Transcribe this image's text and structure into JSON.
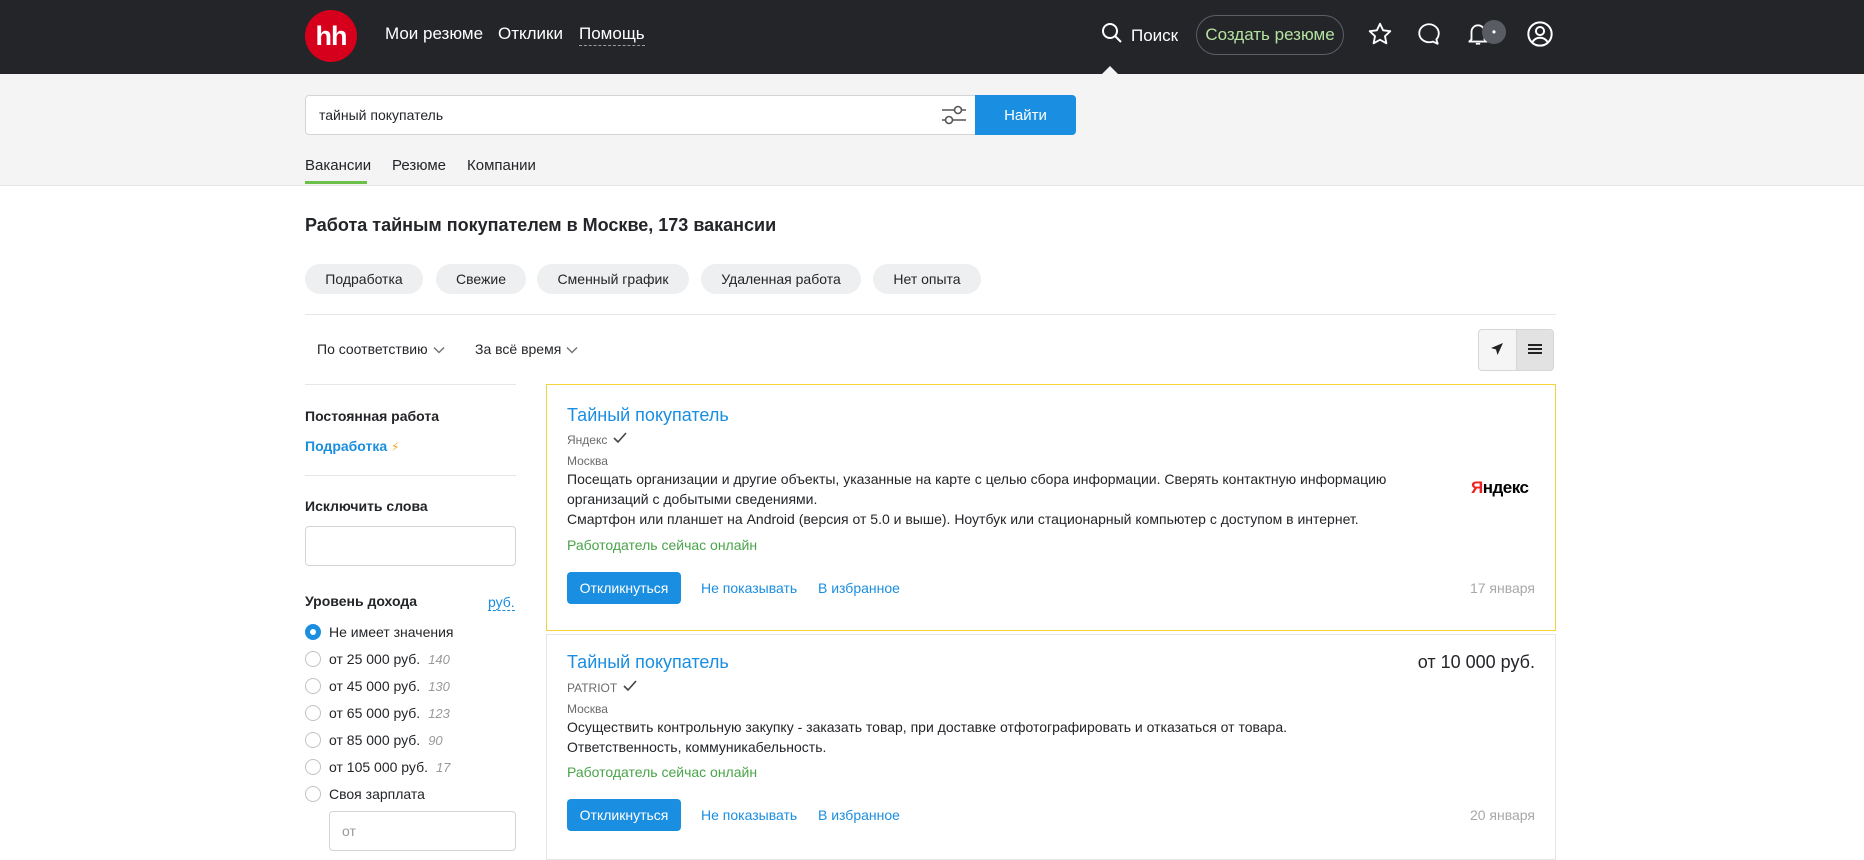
{
  "header": {
    "logo_text": "hh",
    "nav": [
      "Мои резюме",
      "Отклики",
      "Помощь"
    ],
    "search_label": "Поиск",
    "create_resume": "Создать резюме",
    "notifications_badge": "•",
    "colors": {
      "bg": "#232529",
      "logo": "#d6001c",
      "accent_green": "#b6e2a0"
    }
  },
  "search": {
    "query": "тайный покупатель",
    "button": "Найти",
    "tabs": [
      "Вакансии",
      "Резюме",
      "Компании"
    ],
    "active_tab": "Вакансии"
  },
  "results": {
    "title": "Работа тайным покупателем в Москве, 173 вакансии",
    "chips": [
      "Подработка",
      "Свежие",
      "Сменный график",
      "Удаленная работа",
      "Нет опыта"
    ],
    "sort": "По соответствию",
    "period": "За всё время"
  },
  "sidebar": {
    "employment_title": "Постоянная работа",
    "employment_link": "Подработка",
    "exclude_title": "Исключить слова",
    "exclude_value": "",
    "income_title": "Уровень дохода",
    "currency": "руб.",
    "income_options": [
      {
        "label": "Не имеет значения",
        "count": "",
        "checked": true
      },
      {
        "label": "от 25 000 руб.",
        "count": "140",
        "checked": false
      },
      {
        "label": "от 45 000 руб.",
        "count": "130",
        "checked": false
      },
      {
        "label": "от 65 000 руб.",
        "count": "123",
        "checked": false
      },
      {
        "label": "от 85 000 руб.",
        "count": "90",
        "checked": false
      },
      {
        "label": "от 105 000 руб.",
        "count": "17",
        "checked": false
      },
      {
        "label": "Своя зарплата",
        "count": "",
        "checked": false
      }
    ],
    "own_salary_placeholder": "от"
  },
  "vacancies": [
    {
      "title": "Тайный покупатель",
      "company": "Яндекс",
      "city": "Москва",
      "description": [
        "Посещать организации и другие объекты, указанные на карте с целью сбора информации. Сверять контактную информацию организаций с добытыми сведениями.",
        "Смартфон или планшет на Android (версия от 5.0 и выше). Ноутбук или стационарный компьютер с доступом в интернет."
      ],
      "online": "Работодатель сейчас онлайн",
      "apply": "Откликнуться",
      "hide": "Не показывать",
      "favorite": "В избранное",
      "date": "17 января",
      "salary": "",
      "logo_first": "Я",
      "logo_rest": "ндекс"
    },
    {
      "title": "Тайный покупатель",
      "company": "PATRIOT",
      "city": "Москва",
      "description": [
        "Осуществить контрольную закупку - заказать товар, при доставке отфотографировать и отказаться от товара.",
        "Ответственность, коммуникабельность."
      ],
      "online": "Работодатель сейчас онлайн",
      "apply": "Откликнуться",
      "hide": "Не показывать",
      "favorite": "В избранное",
      "date": "20 января",
      "salary": "от 10 000 руб."
    }
  ]
}
